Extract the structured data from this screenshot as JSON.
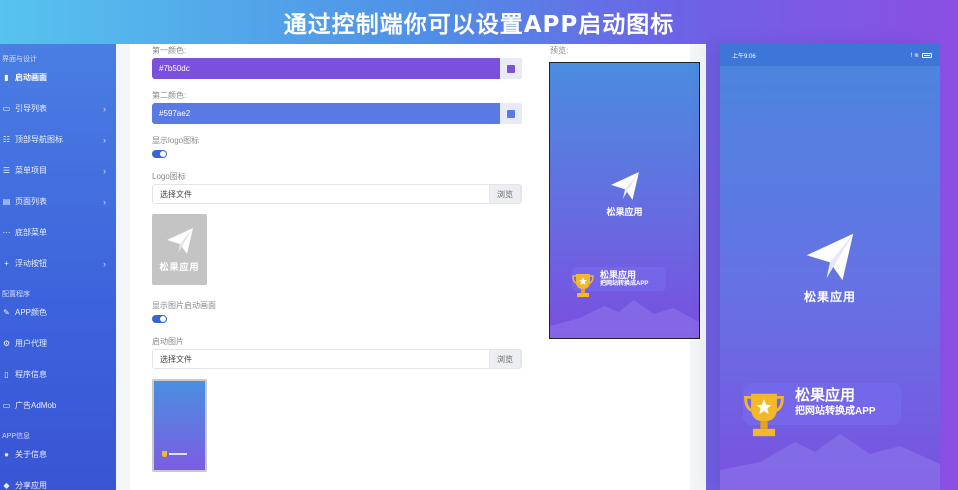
{
  "banner": {
    "title": "通过控制端你可以设置APP启动图标"
  },
  "sidebar": {
    "section1": "界面与设计",
    "items1": [
      {
        "label": "启动画面",
        "icon": "▮",
        "chevron": false,
        "active": true
      },
      {
        "label": "引导列表",
        "icon": "▭",
        "chevron": true
      },
      {
        "label": "顶部导航图标",
        "icon": "☷",
        "chevron": true
      },
      {
        "label": "菜单项目",
        "icon": "☰",
        "chevron": true
      },
      {
        "label": "页面列表",
        "icon": "▤",
        "chevron": true
      },
      {
        "label": "底部菜单",
        "icon": "⋯",
        "chevron": false
      },
      {
        "label": "浮动按钮",
        "icon": "+",
        "chevron": true
      }
    ],
    "section2": "配置程序",
    "items2": [
      {
        "label": "APP颜色",
        "icon": "✎"
      },
      {
        "label": "用户代理",
        "icon": "⚙"
      },
      {
        "label": "程序信息",
        "icon": "▯"
      },
      {
        "label": "广告AdMob",
        "icon": "▭"
      }
    ],
    "section3": "APP信息",
    "items3": [
      {
        "label": "关于信息",
        "icon": "●"
      },
      {
        "label": "分享应用",
        "icon": "◆"
      }
    ],
    "chevron": "›"
  },
  "form": {
    "color1_label": "第一颜色:",
    "color1_value": "#7b50dc",
    "color2_label": "第二颜色:",
    "color2_value": "#597ae2",
    "show_logo_label": "显示logo图标",
    "logo_label": "Logo图标",
    "file_placeholder": "选择文件",
    "browse": "浏览",
    "logo_text": "松果应用",
    "show_splash_label": "显示图片启动画面",
    "splash_label": "启动图片",
    "file_placeholder2": "选择文件",
    "browse2": "浏览"
  },
  "preview": {
    "label": "预览:",
    "logo_text": "松果应用",
    "badge_title": "松果应用",
    "badge_sub": "把网站转换成APP"
  },
  "phone": {
    "time": "上午9:06",
    "status_icons": "ⵑ ≋",
    "logo_text": "松果应用",
    "badge_title": "松果应用",
    "badge_sub": "把网站转换成APP"
  },
  "colors": {
    "first": "#7b50dc",
    "second": "#597ae2",
    "toggle": "#3a63d9",
    "trophy": "#f3b72b"
  }
}
